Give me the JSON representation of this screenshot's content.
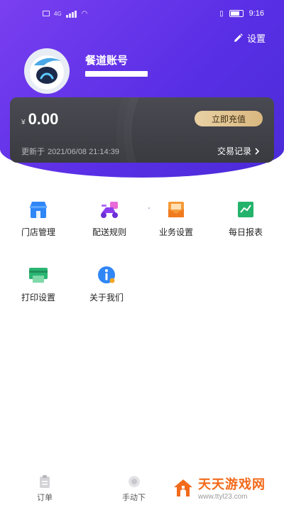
{
  "status_bar": {
    "left_text": "4G",
    "time": "9:16"
  },
  "header": {
    "settings_label": "设置",
    "account_name": "餐道账号"
  },
  "wallet": {
    "currency_symbol": "¥",
    "balance": "0.00",
    "recharge_label": "立即充值",
    "updated_prefix": "更新于",
    "updated_time": "2021/06/08 21:14:39",
    "transactions_label": "交易记录"
  },
  "menu": [
    {
      "label": "门店管理",
      "icon": "store-icon"
    },
    {
      "label": "配送规则",
      "icon": "delivery-scooter-icon"
    },
    {
      "label": "业务设置",
      "icon": "business-envelope-icon"
    },
    {
      "label": "每日报表",
      "icon": "daily-report-chart-icon"
    },
    {
      "label": "打印设置",
      "icon": "printer-icon"
    },
    {
      "label": "关于我们",
      "icon": "info-icon"
    }
  ],
  "tabbar": {
    "tab_orders": "订单",
    "tab_manual": "手动下"
  },
  "watermark": {
    "title": "天天游戏网",
    "url": "www.ttyl23.com"
  },
  "colors": {
    "header_purple": "#5a2fe6",
    "card_dark": "#3f3f46",
    "gold_button": "#e2c28f",
    "watermark_orange": "#f26a1b"
  }
}
